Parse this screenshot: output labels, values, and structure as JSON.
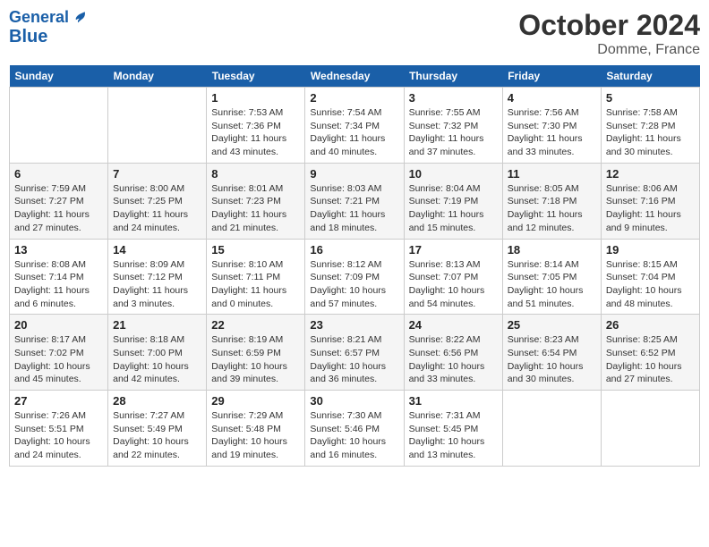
{
  "header": {
    "logo_line1": "General",
    "logo_line2": "Blue",
    "month": "October 2024",
    "location": "Domme, France"
  },
  "weekdays": [
    "Sunday",
    "Monday",
    "Tuesday",
    "Wednesday",
    "Thursday",
    "Friday",
    "Saturday"
  ],
  "weeks": [
    [
      {
        "day": "",
        "sunrise": "",
        "sunset": "",
        "daylight": ""
      },
      {
        "day": "",
        "sunrise": "",
        "sunset": "",
        "daylight": ""
      },
      {
        "day": "1",
        "sunrise": "Sunrise: 7:53 AM",
        "sunset": "Sunset: 7:36 PM",
        "daylight": "Daylight: 11 hours and 43 minutes."
      },
      {
        "day": "2",
        "sunrise": "Sunrise: 7:54 AM",
        "sunset": "Sunset: 7:34 PM",
        "daylight": "Daylight: 11 hours and 40 minutes."
      },
      {
        "day": "3",
        "sunrise": "Sunrise: 7:55 AM",
        "sunset": "Sunset: 7:32 PM",
        "daylight": "Daylight: 11 hours and 37 minutes."
      },
      {
        "day": "4",
        "sunrise": "Sunrise: 7:56 AM",
        "sunset": "Sunset: 7:30 PM",
        "daylight": "Daylight: 11 hours and 33 minutes."
      },
      {
        "day": "5",
        "sunrise": "Sunrise: 7:58 AM",
        "sunset": "Sunset: 7:28 PM",
        "daylight": "Daylight: 11 hours and 30 minutes."
      }
    ],
    [
      {
        "day": "6",
        "sunrise": "Sunrise: 7:59 AM",
        "sunset": "Sunset: 7:27 PM",
        "daylight": "Daylight: 11 hours and 27 minutes."
      },
      {
        "day": "7",
        "sunrise": "Sunrise: 8:00 AM",
        "sunset": "Sunset: 7:25 PM",
        "daylight": "Daylight: 11 hours and 24 minutes."
      },
      {
        "day": "8",
        "sunrise": "Sunrise: 8:01 AM",
        "sunset": "Sunset: 7:23 PM",
        "daylight": "Daylight: 11 hours and 21 minutes."
      },
      {
        "day": "9",
        "sunrise": "Sunrise: 8:03 AM",
        "sunset": "Sunset: 7:21 PM",
        "daylight": "Daylight: 11 hours and 18 minutes."
      },
      {
        "day": "10",
        "sunrise": "Sunrise: 8:04 AM",
        "sunset": "Sunset: 7:19 PM",
        "daylight": "Daylight: 11 hours and 15 minutes."
      },
      {
        "day": "11",
        "sunrise": "Sunrise: 8:05 AM",
        "sunset": "Sunset: 7:18 PM",
        "daylight": "Daylight: 11 hours and 12 minutes."
      },
      {
        "day": "12",
        "sunrise": "Sunrise: 8:06 AM",
        "sunset": "Sunset: 7:16 PM",
        "daylight": "Daylight: 11 hours and 9 minutes."
      }
    ],
    [
      {
        "day": "13",
        "sunrise": "Sunrise: 8:08 AM",
        "sunset": "Sunset: 7:14 PM",
        "daylight": "Daylight: 11 hours and 6 minutes."
      },
      {
        "day": "14",
        "sunrise": "Sunrise: 8:09 AM",
        "sunset": "Sunset: 7:12 PM",
        "daylight": "Daylight: 11 hours and 3 minutes."
      },
      {
        "day": "15",
        "sunrise": "Sunrise: 8:10 AM",
        "sunset": "Sunset: 7:11 PM",
        "daylight": "Daylight: 11 hours and 0 minutes."
      },
      {
        "day": "16",
        "sunrise": "Sunrise: 8:12 AM",
        "sunset": "Sunset: 7:09 PM",
        "daylight": "Daylight: 10 hours and 57 minutes."
      },
      {
        "day": "17",
        "sunrise": "Sunrise: 8:13 AM",
        "sunset": "Sunset: 7:07 PM",
        "daylight": "Daylight: 10 hours and 54 minutes."
      },
      {
        "day": "18",
        "sunrise": "Sunrise: 8:14 AM",
        "sunset": "Sunset: 7:05 PM",
        "daylight": "Daylight: 10 hours and 51 minutes."
      },
      {
        "day": "19",
        "sunrise": "Sunrise: 8:15 AM",
        "sunset": "Sunset: 7:04 PM",
        "daylight": "Daylight: 10 hours and 48 minutes."
      }
    ],
    [
      {
        "day": "20",
        "sunrise": "Sunrise: 8:17 AM",
        "sunset": "Sunset: 7:02 PM",
        "daylight": "Daylight: 10 hours and 45 minutes."
      },
      {
        "day": "21",
        "sunrise": "Sunrise: 8:18 AM",
        "sunset": "Sunset: 7:00 PM",
        "daylight": "Daylight: 10 hours and 42 minutes."
      },
      {
        "day": "22",
        "sunrise": "Sunrise: 8:19 AM",
        "sunset": "Sunset: 6:59 PM",
        "daylight": "Daylight: 10 hours and 39 minutes."
      },
      {
        "day": "23",
        "sunrise": "Sunrise: 8:21 AM",
        "sunset": "Sunset: 6:57 PM",
        "daylight": "Daylight: 10 hours and 36 minutes."
      },
      {
        "day": "24",
        "sunrise": "Sunrise: 8:22 AM",
        "sunset": "Sunset: 6:56 PM",
        "daylight": "Daylight: 10 hours and 33 minutes."
      },
      {
        "day": "25",
        "sunrise": "Sunrise: 8:23 AM",
        "sunset": "Sunset: 6:54 PM",
        "daylight": "Daylight: 10 hours and 30 minutes."
      },
      {
        "day": "26",
        "sunrise": "Sunrise: 8:25 AM",
        "sunset": "Sunset: 6:52 PM",
        "daylight": "Daylight: 10 hours and 27 minutes."
      }
    ],
    [
      {
        "day": "27",
        "sunrise": "Sunrise: 7:26 AM",
        "sunset": "Sunset: 5:51 PM",
        "daylight": "Daylight: 10 hours and 24 minutes."
      },
      {
        "day": "28",
        "sunrise": "Sunrise: 7:27 AM",
        "sunset": "Sunset: 5:49 PM",
        "daylight": "Daylight: 10 hours and 22 minutes."
      },
      {
        "day": "29",
        "sunrise": "Sunrise: 7:29 AM",
        "sunset": "Sunset: 5:48 PM",
        "daylight": "Daylight: 10 hours and 19 minutes."
      },
      {
        "day": "30",
        "sunrise": "Sunrise: 7:30 AM",
        "sunset": "Sunset: 5:46 PM",
        "daylight": "Daylight: 10 hours and 16 minutes."
      },
      {
        "day": "31",
        "sunrise": "Sunrise: 7:31 AM",
        "sunset": "Sunset: 5:45 PM",
        "daylight": "Daylight: 10 hours and 13 minutes."
      },
      {
        "day": "",
        "sunrise": "",
        "sunset": "",
        "daylight": ""
      },
      {
        "day": "",
        "sunrise": "",
        "sunset": "",
        "daylight": ""
      }
    ]
  ]
}
